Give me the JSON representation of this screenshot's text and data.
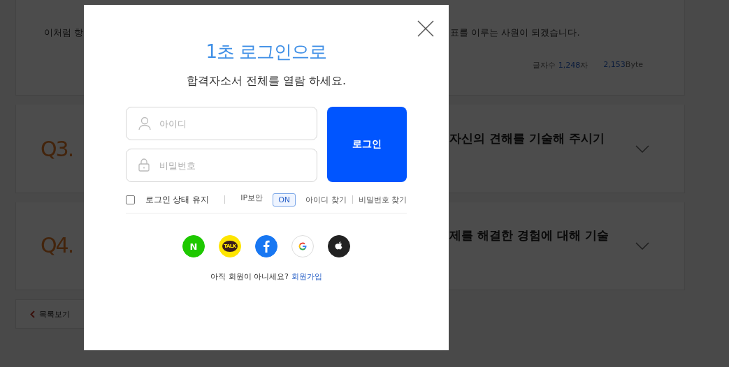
{
  "background_page": {
    "answer_card": {
      "text_left": "이처럼 항",
      "text_right": "표를 이루는 사원이 되겠습니다.",
      "char_count_label": "글자수",
      "char_count_value": "1,248",
      "char_count_unit": "자",
      "byte_value": "2,153",
      "byte_unit": "Byte"
    },
    "questions": [
      {
        "number": "Q3.",
        "title": "자신의 견해를 기술해 주시기",
        "expanded": false
      },
      {
        "number": "Q4.",
        "title": "제를 해결한 경험에 대해 기술",
        "expanded": false
      }
    ],
    "list_button": "목록보기"
  },
  "login_modal": {
    "title": "1초 로그인으로",
    "subtitle": "합격자소서 전체를 열람 하세요.",
    "id_field": {
      "placeholder": "아이디"
    },
    "password_field": {
      "placeholder": "비밀번호"
    },
    "login_button": "로그인",
    "keep_logged_in": {
      "label": "로그인 상태 유지",
      "checked": false
    },
    "ip_security": {
      "label": "IP보안",
      "toggle": "ON",
      "on": true
    },
    "links": [
      "아이디 찾기",
      "비밀번호 찾기"
    ],
    "social_logins": [
      {
        "kind": "naver",
        "glyph": "N"
      },
      {
        "kind": "kakao",
        "glyph": "TALK"
      },
      {
        "kind": "facebook"
      },
      {
        "kind": "google"
      },
      {
        "kind": "apple"
      }
    ],
    "signup_prompt": "아직 회원이 아니세요?",
    "signup_link": "회원가입"
  }
}
